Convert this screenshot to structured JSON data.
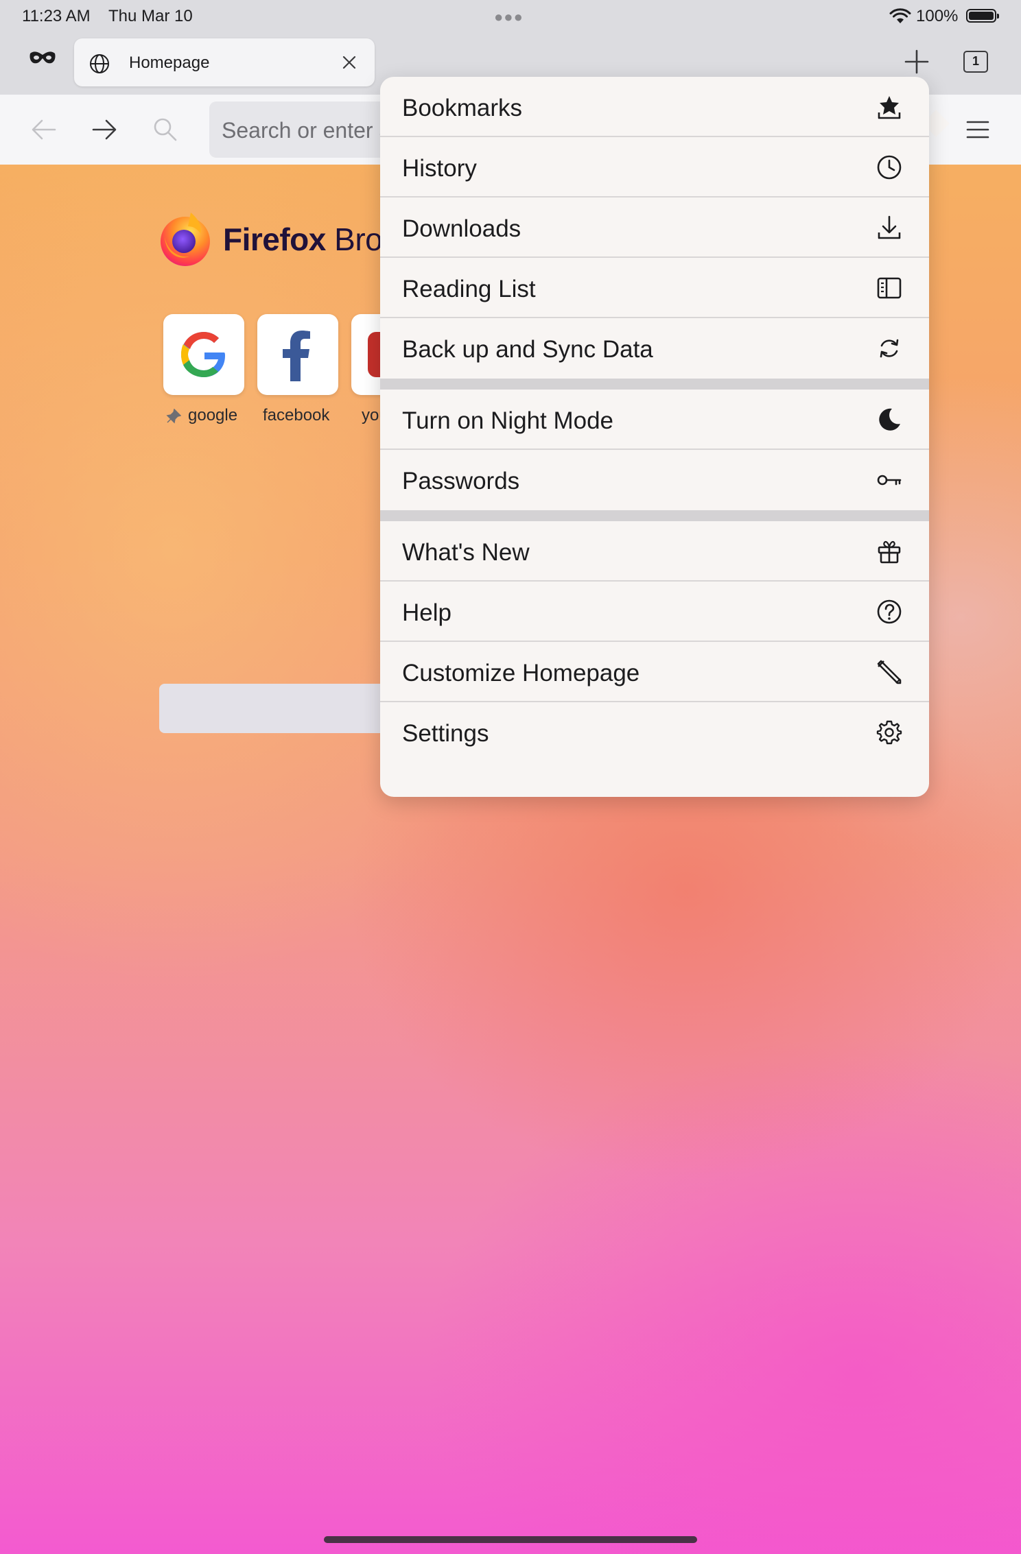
{
  "status_bar": {
    "time": "11:23 AM",
    "date": "Thu Mar 10",
    "battery": "100%"
  },
  "tab_bar": {
    "tabs": [
      {
        "title": "Homepage"
      }
    ],
    "tab_count": "1"
  },
  "toolbar": {
    "url_placeholder": "Search or enter address"
  },
  "home": {
    "brand_bold": "Firefox",
    "brand_light": " Browser",
    "shortcuts": [
      {
        "label": "google",
        "pinned": true
      },
      {
        "label": "facebook",
        "pinned": false
      },
      {
        "label": "youtube",
        "pinned": false
      }
    ]
  },
  "menu": {
    "sections": [
      [
        {
          "label": "Bookmarks",
          "icon": "bookmark-star-icon"
        },
        {
          "label": "History",
          "icon": "clock-icon"
        },
        {
          "label": "Downloads",
          "icon": "download-icon"
        },
        {
          "label": "Reading List",
          "icon": "reading-list-icon"
        },
        {
          "label": "Back up and Sync Data",
          "icon": "sync-icon"
        }
      ],
      [
        {
          "label": "Turn on Night Mode",
          "icon": "moon-icon"
        },
        {
          "label": "Passwords",
          "icon": "key-icon"
        }
      ],
      [
        {
          "label": "What's New",
          "icon": "gift-icon"
        },
        {
          "label": "Help",
          "icon": "help-icon"
        },
        {
          "label": "Customize Homepage",
          "icon": "pencil-icon"
        },
        {
          "label": "Settings",
          "icon": "gear-icon"
        }
      ]
    ]
  }
}
